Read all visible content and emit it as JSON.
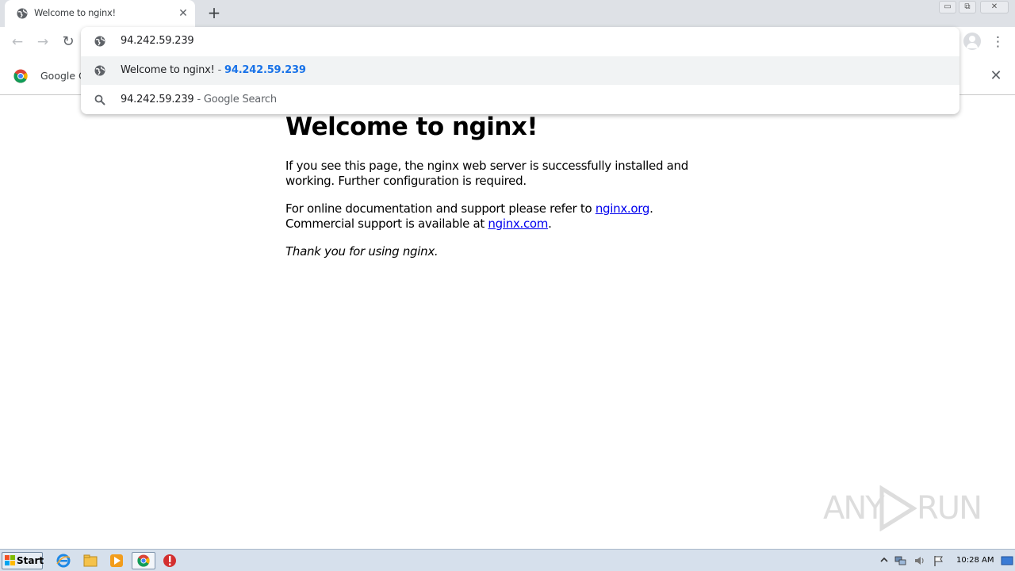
{
  "browser": {
    "tab": {
      "title": "Welcome to nginx!",
      "close_glyph": "✕"
    },
    "new_tab_glyph": "+",
    "window_controls": {
      "minimize": "▭",
      "restore": "⧉",
      "close": "✕"
    },
    "toolbar": {
      "back_glyph": "←",
      "forward_glyph": "→",
      "reload_glyph": "↻",
      "menu_glyph": "⋮"
    },
    "infobar": {
      "label": "Google Ch",
      "close_glyph": "✕"
    }
  },
  "omnibox": {
    "input_value": "94.242.59.239",
    "suggestions": [
      {
        "title": "Welcome to nginx!",
        "separator": " - ",
        "url": "94.242.59.239",
        "icon": "globe-icon"
      },
      {
        "query": "94.242.59.239",
        "separator": " - ",
        "hint": "Google Search",
        "icon": "search-icon"
      }
    ]
  },
  "page": {
    "heading": "Welcome to nginx!",
    "para1": "If you see this page, the nginx web server is successfully installed and working. Further configuration is required.",
    "para2_prefix": "For online documentation and support please refer to ",
    "para2_link": "nginx.org",
    "para2_mid": ".",
    "para2_line2_prefix": "Commercial support is available at ",
    "para2_line2_link": "nginx.com",
    "para2_line2_suffix": ".",
    "para3": "Thank you for using nginx."
  },
  "watermark": {
    "left": "ANY",
    "right": "RUN"
  },
  "taskbar": {
    "start_label": "Start",
    "icons": [
      "ie-icon",
      "explorer-icon",
      "media-player-icon",
      "chrome-icon",
      "stop-icon"
    ],
    "clock": "10:28 AM"
  },
  "colors": {
    "link": "#0000ee",
    "omnibox_url": "#1a73e8",
    "tabstrip": "#dee1e6",
    "taskbar": "#d6e0ec"
  }
}
